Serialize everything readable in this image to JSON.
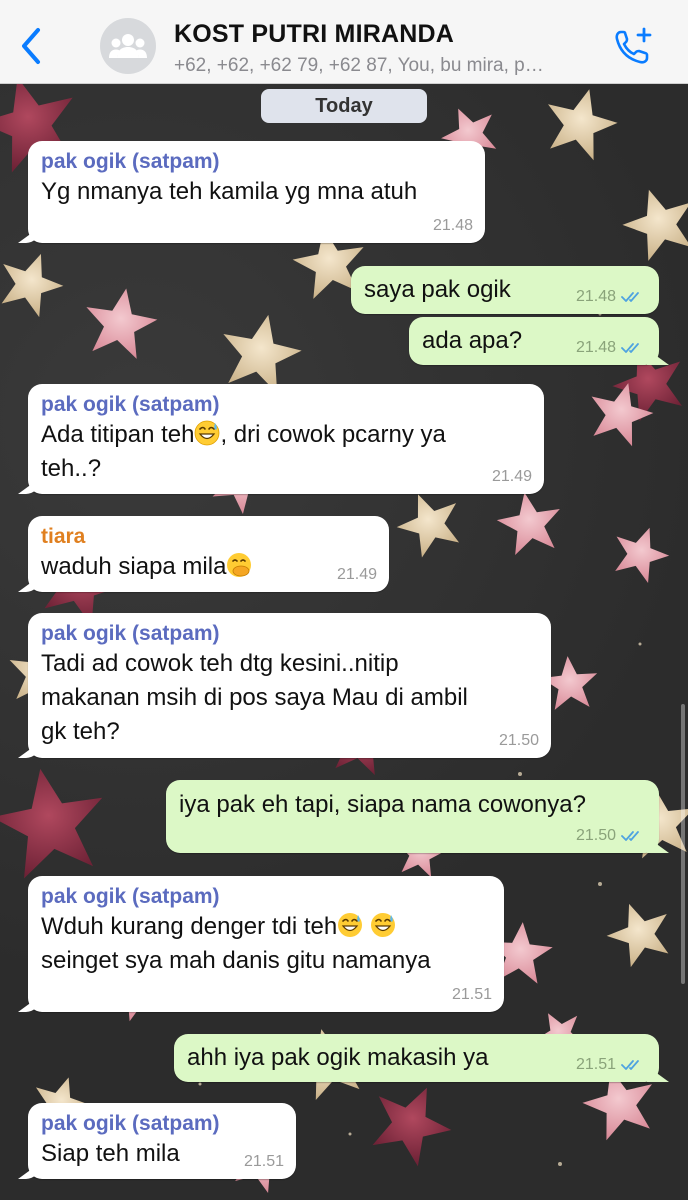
{
  "header": {
    "title": "KOST PUTRI MIRANDA",
    "members": "+62, +62, +62 79, +62 87, You, bu mira, p…",
    "back_icon": "chevron-left-icon",
    "avatar_icon": "group-avatar-icon",
    "call_icon": "add-call-icon",
    "accent_color": "#0a7cff"
  },
  "date_divider": "Today",
  "colors": {
    "incoming_bubble": "#ffffff",
    "outgoing_bubble": "#dcf8c6",
    "sender_pak_ogik": "#5b6bbf",
    "sender_tiara": "#e08020",
    "read_ticks": "#4fa3e0"
  },
  "messages": [
    {
      "direction": "in",
      "sender": "pak ogik (satpam)",
      "text": "Yg nmanya teh kamila yg mna atuh",
      "time": "21.48"
    },
    {
      "direction": "out",
      "text": "saya pak ogik",
      "time": "21.48",
      "status": "read"
    },
    {
      "direction": "out",
      "text": "ada apa?",
      "time": "21.48",
      "status": "read"
    },
    {
      "direction": "in",
      "sender": "pak ogik (satpam)",
      "text_before_emoji": "Ada titipan teh",
      "emoji": "grinning-sweat-emoji",
      "text_after_emoji": ", dri cowok pcarny ya",
      "text_line2": "teh..?",
      "time": "21.49"
    },
    {
      "direction": "in",
      "sender": "tiara",
      "text": "waduh siapa mila",
      "emoji": "hand-over-mouth-emoji",
      "time": "21.49"
    },
    {
      "direction": "in",
      "sender": "pak ogik (satpam)",
      "text_line1": "Tadi ad cowok teh dtg kesini..nitip",
      "text_line2": "makanan msih di pos saya Mau di ambil",
      "text_line3": "gk teh?",
      "time": "21.50"
    },
    {
      "direction": "out",
      "text": "iya pak eh tapi, siapa nama cowonya?",
      "time": "21.50",
      "status": "read"
    },
    {
      "direction": "in",
      "sender": "pak ogik (satpam)",
      "text_line1": "Wduh kurang denger tdi teh",
      "emoji": "grinning-sweat-emoji",
      "text_line2": "seinget sya mah danis gitu namanya",
      "time": "21.51"
    },
    {
      "direction": "out",
      "text": "ahh iya pak ogik makasih ya",
      "time": "21.51",
      "status": "read"
    },
    {
      "direction": "in",
      "sender": "pak ogik (satpam)",
      "text": "Siap teh mila",
      "time": "21.51"
    }
  ]
}
